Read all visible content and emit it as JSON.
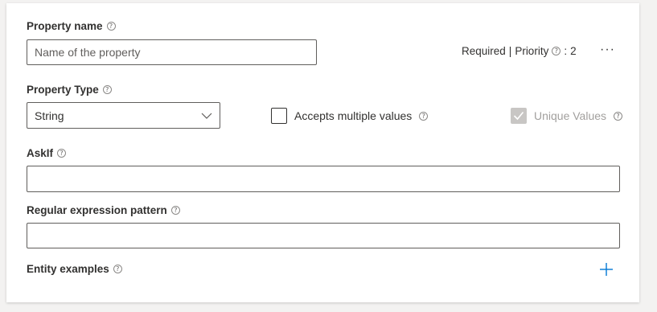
{
  "property_name": {
    "label": "Property name",
    "placeholder": "Name of the property",
    "value": ""
  },
  "meta": {
    "required_label": "Required",
    "separator": "|",
    "priority_label": "Priority",
    "priority_separator": ":",
    "priority_value": "2",
    "more_label": "···"
  },
  "property_type": {
    "label": "Property Type",
    "selected": "String"
  },
  "accepts_multiple": {
    "label": "Accepts multiple values",
    "checked": false
  },
  "unique_values": {
    "label": "Unique Values",
    "checked": true,
    "disabled": true
  },
  "askif": {
    "label": "AskIf",
    "value": ""
  },
  "regex": {
    "label": "Regular expression pattern",
    "value": ""
  },
  "entity_examples": {
    "label": "Entity examples",
    "add_label": "+"
  },
  "icons": {
    "help": "help-circle-icon",
    "dropdown": "chevron-down-icon",
    "check": "checkmark-icon",
    "add": "plus-icon"
  },
  "colors": {
    "accent": "#0078d4",
    "disabled": "#c8c6c4",
    "text": "#323130",
    "background": "#f3f2f1"
  }
}
